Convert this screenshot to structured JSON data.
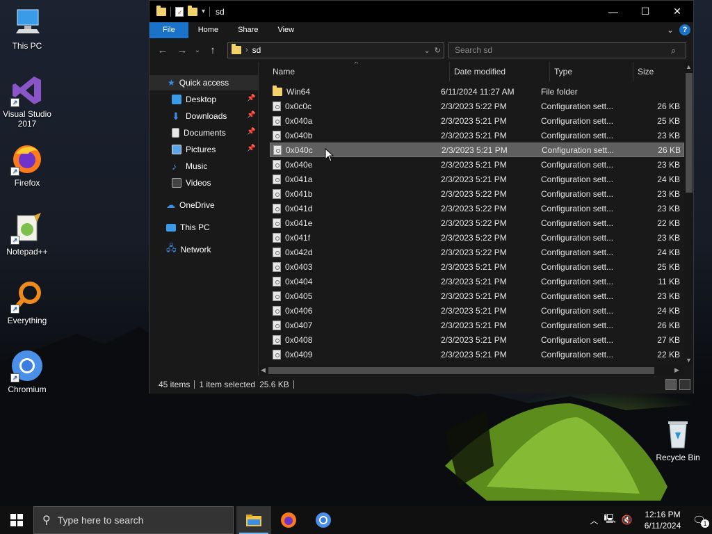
{
  "desktop": {
    "icons": [
      {
        "label": "This PC"
      },
      {
        "label": "Visual Studio 2017"
      },
      {
        "label": "Firefox"
      },
      {
        "label": "Notepad++"
      },
      {
        "label": "Everything"
      },
      {
        "label": "Chromium"
      },
      {
        "label": "Recycle Bin"
      }
    ]
  },
  "window": {
    "title": "sd",
    "ribbon_tabs": [
      "File",
      "Home",
      "Share",
      "View"
    ],
    "address": "sd",
    "search_placeholder": "Search sd",
    "nav": {
      "quick_access": "Quick access",
      "items": [
        "Desktop",
        "Downloads",
        "Documents",
        "Pictures",
        "Music",
        "Videos"
      ],
      "onedrive": "OneDrive",
      "this_pc": "This PC",
      "network": "Network"
    },
    "columns": [
      "Name",
      "Date modified",
      "Type",
      "Size"
    ],
    "rows": [
      {
        "name": "Win64",
        "date": "6/11/2024 11:27 AM",
        "type": "File folder",
        "size": "",
        "folder": true
      },
      {
        "name": "0x0c0c",
        "date": "2/3/2023 5:22 PM",
        "type": "Configuration sett...",
        "size": "26 KB"
      },
      {
        "name": "0x040a",
        "date": "2/3/2023 5:21 PM",
        "type": "Configuration sett...",
        "size": "25 KB"
      },
      {
        "name": "0x040b",
        "date": "2/3/2023 5:21 PM",
        "type": "Configuration sett...",
        "size": "23 KB"
      },
      {
        "name": "0x040c",
        "date": "2/3/2023 5:21 PM",
        "type": "Configuration sett...",
        "size": "26 KB",
        "selected": true
      },
      {
        "name": "0x040e",
        "date": "2/3/2023 5:21 PM",
        "type": "Configuration sett...",
        "size": "23 KB"
      },
      {
        "name": "0x041a",
        "date": "2/3/2023 5:21 PM",
        "type": "Configuration sett...",
        "size": "24 KB"
      },
      {
        "name": "0x041b",
        "date": "2/3/2023 5:22 PM",
        "type": "Configuration sett...",
        "size": "23 KB"
      },
      {
        "name": "0x041d",
        "date": "2/3/2023 5:22 PM",
        "type": "Configuration sett...",
        "size": "23 KB"
      },
      {
        "name": "0x041e",
        "date": "2/3/2023 5:22 PM",
        "type": "Configuration sett...",
        "size": "22 KB"
      },
      {
        "name": "0x041f",
        "date": "2/3/2023 5:22 PM",
        "type": "Configuration sett...",
        "size": "23 KB"
      },
      {
        "name": "0x042d",
        "date": "2/3/2023 5:22 PM",
        "type": "Configuration sett...",
        "size": "24 KB"
      },
      {
        "name": "0x0403",
        "date": "2/3/2023 5:21 PM",
        "type": "Configuration sett...",
        "size": "25 KB"
      },
      {
        "name": "0x0404",
        "date": "2/3/2023 5:21 PM",
        "type": "Configuration sett...",
        "size": "11 KB"
      },
      {
        "name": "0x0405",
        "date": "2/3/2023 5:21 PM",
        "type": "Configuration sett...",
        "size": "23 KB"
      },
      {
        "name": "0x0406",
        "date": "2/3/2023 5:21 PM",
        "type": "Configuration sett...",
        "size": "24 KB"
      },
      {
        "name": "0x0407",
        "date": "2/3/2023 5:21 PM",
        "type": "Configuration sett...",
        "size": "26 KB"
      },
      {
        "name": "0x0408",
        "date": "2/3/2023 5:21 PM",
        "type": "Configuration sett...",
        "size": "27 KB"
      },
      {
        "name": "0x0409",
        "date": "2/3/2023 5:21 PM",
        "type": "Configuration sett...",
        "size": "22 KB"
      }
    ],
    "status": {
      "items": "45 items",
      "selected": "1 item selected",
      "size": "25.6 KB"
    }
  },
  "taskbar": {
    "search_placeholder": "Type here to search",
    "time": "12:16 PM",
    "date": "6/11/2024",
    "notification_count": "1"
  },
  "colors": {
    "accent": "#1a73c8",
    "folder": "#f4d26b"
  }
}
